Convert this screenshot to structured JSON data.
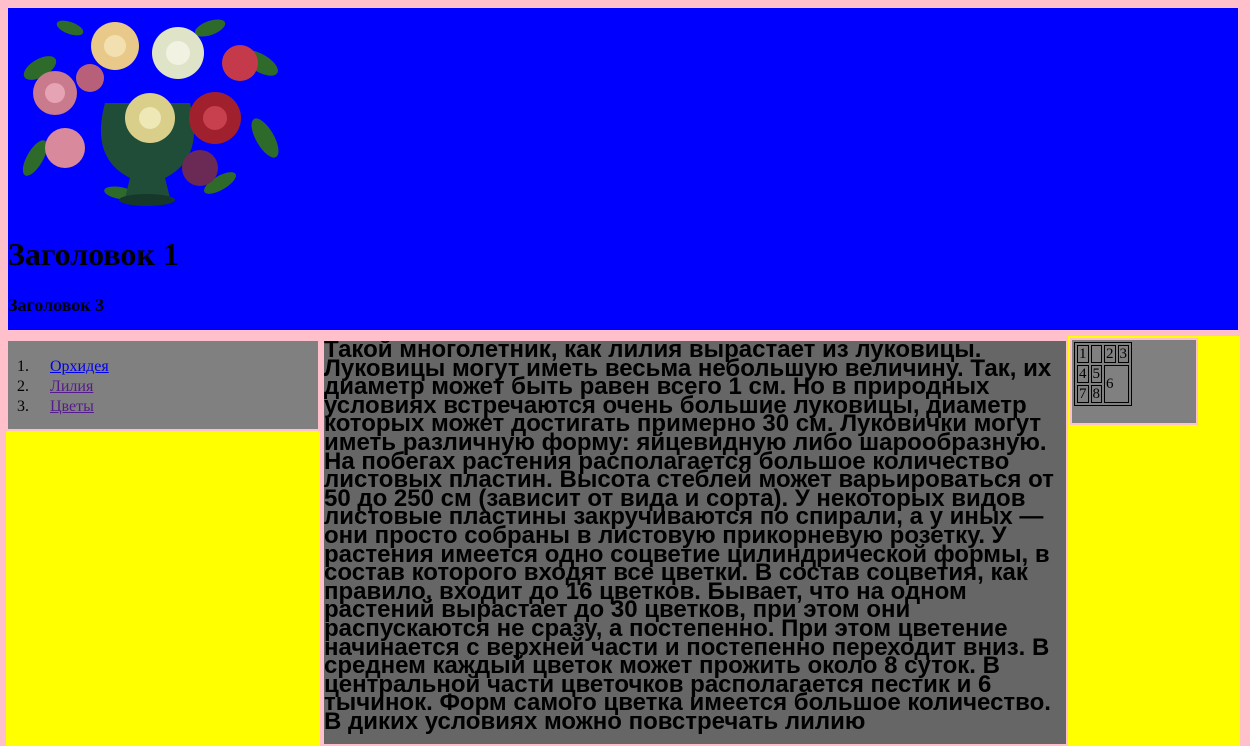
{
  "header": {
    "bg_color": "#0000ff",
    "image": "flower-bouquet-vase",
    "h1": "Заголовок 1",
    "h3": "Заголовок 3"
  },
  "menu": {
    "bg_color": "#808080",
    "items": [
      {
        "num": "1.",
        "label": "Орхидея"
      },
      {
        "num": "2.",
        "label": "Лилия"
      },
      {
        "num": "3.",
        "label": "Цветы"
      }
    ]
  },
  "content": {
    "bg_color": "#666666",
    "text": "Такой многолетник, как лилия вырастает из луковицы. Луковицы могут иметь весьма небольшую величину. Так, их диаметр может быть равен всего 1 см. Но в природных условиях встречаются очень большие луковицы, диаметр которых может достигать примерно 30 см. Луковички могут иметь различную форму: яйцевидную либо шарообразную. На побегах растения располагается большое количество листовых пластин. Высота стеблей может варьироваться от 50 до 250 см (зависит от вида и сорта). У некоторых видов листовые пластины закручиваются по спирали, а у иных — они просто собраны в листовую прикорневую розетку. У растения имеется одно соцветие цилиндрической формы, в состав которого входят все цветки. В состав соцветия, как правило, входит до 16 цветков. Бывает, что на одном растений вырастает до 30 цветков, при этом они распускаются не сразу, а постепенно. При этом цветение начинается с верхней части и постепенно переходит вниз. В среднем каждый цветок может прожить около 8 суток. В центральной части цветочков располагается пестик и 6 тычинок. Форм самого цветка имеется большое количество. В диких условиях можно повстречать лилию"
  },
  "grid": {
    "cells": [
      "1",
      "2",
      "3",
      "4",
      "5",
      "6",
      "7",
      "8"
    ]
  },
  "colors": {
    "page_bg": "#ffc0cb",
    "sidebar_bg": "#ffff00"
  }
}
